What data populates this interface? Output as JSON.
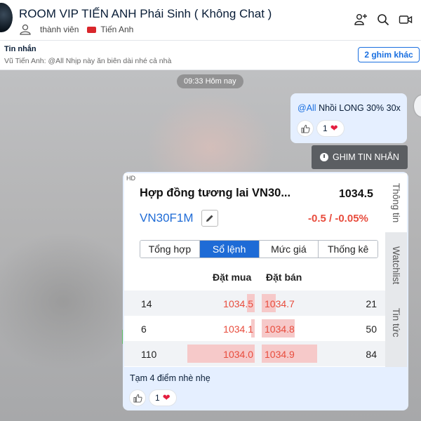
{
  "header": {
    "title": "ROOM VIP TIẾN ANH Phái Sinh ( Không Chat )",
    "members_label": "thành viên",
    "tag_label": "Tiến Anh"
  },
  "pinned": {
    "title": "Tin nhắn",
    "preview": "Vũ Tiến Anh: @All Nhịp này ăn biên dài nhé cả nhà",
    "more_button": "2 ghim khác"
  },
  "chat": {
    "time_label": "09:33 Hôm nay",
    "message1": {
      "mention": "@All",
      "text": " Nhồi LONG 30% 30x",
      "reaction_count": "1"
    },
    "pin_button": "GHIM TIN NHẮN",
    "image_message": {
      "hd_label": "HD",
      "caption": "Tạm 4 điểm nhè nhẹ",
      "reaction_count": "1"
    }
  },
  "quote": {
    "title": "Hợp đồng tương lai VN30...",
    "price": "1034.5",
    "code": "VN30F1M",
    "change": "-0.5 / -0.05%",
    "tabs": [
      "Tổng hợp",
      "Sổ lệnh",
      "Mức giá",
      "Thống kê"
    ],
    "active_tab": "Sổ lệnh",
    "bid_header": "Đặt mua",
    "ask_header": "Đặt bán",
    "orderbook": [
      {
        "bid_qty": "14",
        "bid": "1034.5",
        "ask": "1034.7",
        "ask_qty": "21",
        "bid_depth": 0.11,
        "ask_depth": 0.11
      },
      {
        "bid_qty": "6",
        "bid": "1034.1",
        "ask": "1034.8",
        "ask_qty": "50",
        "bid_depth": 0.05,
        "ask_depth": 0.26
      },
      {
        "bid_qty": "110",
        "bid": "1034.0",
        "ask": "1034.9",
        "ask_qty": "84",
        "bid_depth": 1.0,
        "ask_depth": 0.44
      }
    ],
    "side_tabs": [
      "Thông tin",
      "Watchlist",
      "Tin tức"
    ]
  },
  "colors": {
    "accent": "#1a6fe0",
    "negative": "#e84c3d",
    "bubble": "#e5efff",
    "heart": "#e41e3f"
  }
}
